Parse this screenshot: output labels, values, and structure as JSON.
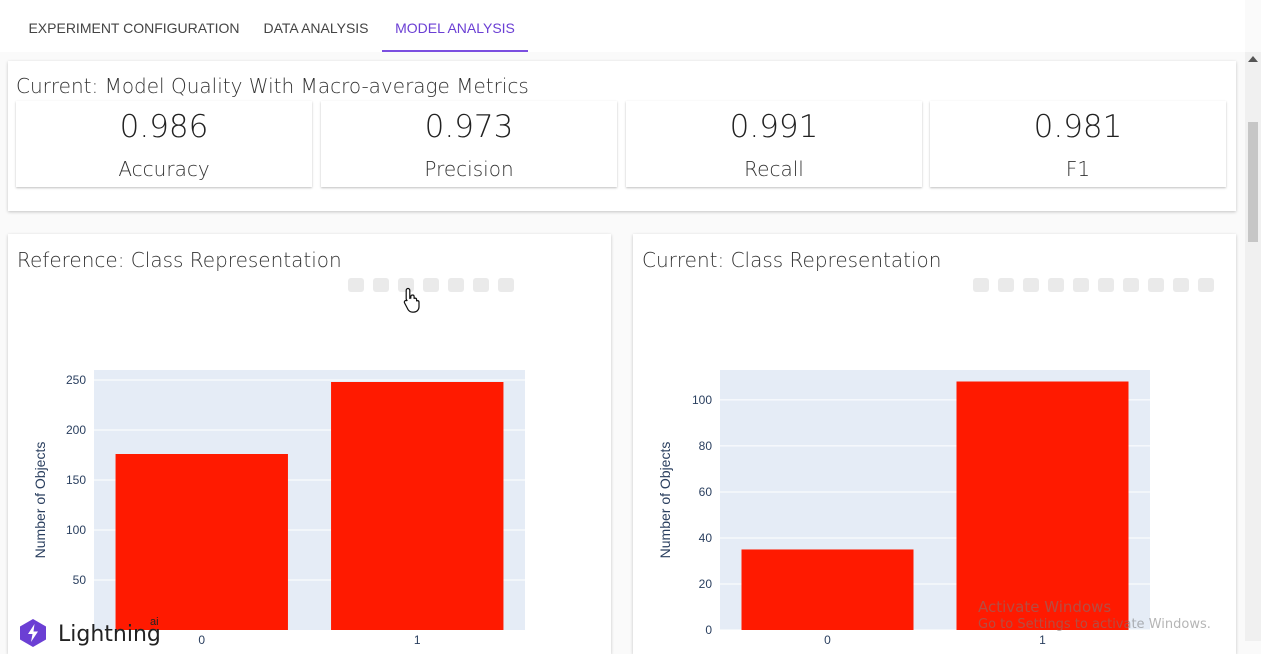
{
  "tabs": [
    {
      "label": "EXPERIMENT CONFIGURATION",
      "active": false
    },
    {
      "label": "DATA ANALYSIS",
      "active": false
    },
    {
      "label": "MODEL ANALYSIS",
      "active": true
    }
  ],
  "accent_color": "#7b4fe0",
  "metrics_card": {
    "title": "Current: Model Quality With Macro-average Metrics",
    "metrics": [
      {
        "value": "0.986",
        "label": "Accuracy"
      },
      {
        "value": "0.973",
        "label": "Precision"
      },
      {
        "value": "0.991",
        "label": "Recall"
      },
      {
        "value": "0.981",
        "label": "F1"
      }
    ]
  },
  "charts": {
    "reference": {
      "title": "Reference: Class Representation"
    },
    "current": {
      "title": "Current: Class Representation"
    }
  },
  "chart_data": [
    {
      "type": "bar",
      "title": "Reference: Class Representation",
      "categories": [
        "0",
        "1"
      ],
      "values": [
        176,
        248
      ],
      "ylabel": "Number of Objects",
      "xlabel": "",
      "ylim": [
        0,
        260
      ],
      "yticks": [
        50,
        100,
        150,
        200,
        250
      ],
      "bar_color": "#ff1a00",
      "grid": true
    },
    {
      "type": "bar",
      "title": "Current: Class Representation",
      "categories": [
        "0",
        "1"
      ],
      "values": [
        35,
        108
      ],
      "ylabel": "Number of Objects",
      "xlabel": "",
      "ylim": [
        0,
        113
      ],
      "yticks": [
        0,
        20,
        40,
        60,
        80,
        100
      ],
      "bar_color": "#ff1a00",
      "grid": true
    }
  ],
  "watermark": {
    "line1": "Activate Windows",
    "line2": "Go to Settings to activate Windows."
  },
  "logo": {
    "text": "Lightning",
    "sup": "ai"
  }
}
